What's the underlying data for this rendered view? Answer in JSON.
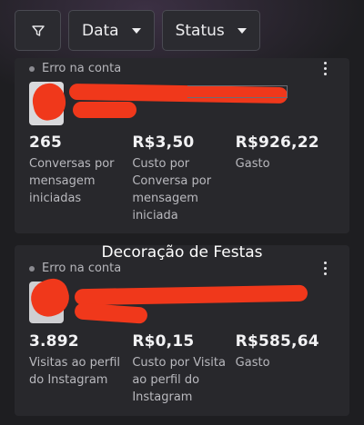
{
  "filters": {
    "filter_icon": "filter-icon",
    "data_label": "Data",
    "status_label": "Status"
  },
  "cards": [
    {
      "status": "Erro na conta",
      "metrics": [
        {
          "value": "265",
          "label": "Conversas por mensagem iniciadas"
        },
        {
          "value": "R$3,50",
          "label": "Custo por Conversa por mensagem iniciada"
        },
        {
          "value": "R$926,22",
          "label": "Gasto"
        }
      ]
    },
    {
      "status": "Erro na conta",
      "metrics": [
        {
          "value": "3.892",
          "label": "Visitas ao perfil do Instagram"
        },
        {
          "value": "R$0,15",
          "label": "Custo por Visita ao perfil do Instagram"
        },
        {
          "value": "R$585,64",
          "label": "Gasto"
        }
      ]
    }
  ],
  "overlay_caption": "Decoração de Festas",
  "colors": {
    "background": "#1e1e21",
    "card": "#28282c",
    "redaction": "#f0381b"
  }
}
